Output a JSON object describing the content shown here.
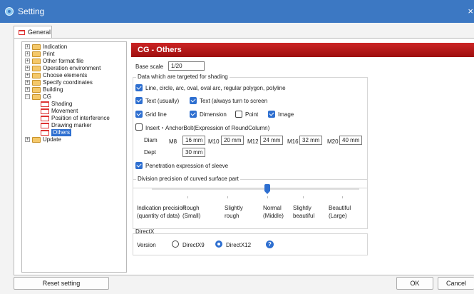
{
  "window": {
    "title": "Setting",
    "close_symbol": "×"
  },
  "tabs": [
    {
      "label": "General"
    }
  ],
  "tree": {
    "items": [
      {
        "label": "Indication",
        "expander": "+"
      },
      {
        "label": "Print",
        "expander": "+"
      },
      {
        "label": "Other format file",
        "expander": "+"
      },
      {
        "label": "Operation environment",
        "expander": "+"
      },
      {
        "label": "Choose elements",
        "expander": "+"
      },
      {
        "label": "Specify coordinates",
        "expander": "+"
      },
      {
        "label": "Building",
        "expander": "+"
      },
      {
        "label": "CG",
        "expander": "−"
      },
      {
        "label": "Shading"
      },
      {
        "label": "Movement"
      },
      {
        "label": "Position of interference"
      },
      {
        "label": "Drawing marker"
      },
      {
        "label": "Others",
        "selected": true
      },
      {
        "label": "Update",
        "expander": "+"
      }
    ]
  },
  "panel": {
    "header": "CG - Others",
    "base_scale": {
      "label": "Base scale",
      "value": "1/20"
    },
    "shading": {
      "title": "Data which are targeted for shading",
      "line_items": {
        "label": "Line, circle, arc, oval, oval arc, regular polygon, polyline",
        "checked": true
      },
      "text_usually": {
        "label": "Text (usually)",
        "checked": true
      },
      "text_screen": {
        "label": "Text (always turn to screen",
        "checked": true
      },
      "grid_line": {
        "label": "Grid line",
        "checked": true
      },
      "dimension": {
        "label": "Dimension",
        "checked": true
      },
      "point": {
        "label": "Point",
        "checked": false
      },
      "image": {
        "label": "Image",
        "checked": true
      },
      "insert_anchor": {
        "label": "Insert・AnchorBolt(Expression of RoundColumn)",
        "checked": false
      },
      "diam_label": "Diam",
      "dept_label": "Dept",
      "sizes": [
        {
          "label": "M8",
          "value": "16 mm"
        },
        {
          "label": "M10",
          "value": "20 mm"
        },
        {
          "label": "M12",
          "value": "24 mm"
        },
        {
          "label": "M16",
          "value": "32 mm"
        },
        {
          "label": "M20",
          "value": "40 mm"
        }
      ],
      "dept_value": "30 mm",
      "penetration": {
        "label": "Penetration expression of sleeve",
        "checked": true
      }
    },
    "division": {
      "title": "Division precision of curved surface part",
      "indication_label_1": "Indication precision",
      "indication_label_2": "(quantity of data)",
      "levels": [
        {
          "line1": "Rough",
          "line2": "(Small)"
        },
        {
          "line1": "Slightly",
          "line2": "rough"
        },
        {
          "line1": "Normal",
          "line2": "(Middle)"
        },
        {
          "line1": "Slightly",
          "line2": "beautiful"
        },
        {
          "line1": "Beautiful",
          "line2": "(Large)"
        }
      ],
      "selected_level": "Normal"
    },
    "directx": {
      "title": "DirectX",
      "version_label": "Version",
      "options": [
        {
          "label": "DirectX9",
          "checked": false
        },
        {
          "label": "DirectX12",
          "checked": true
        }
      ],
      "help_symbol": "?"
    }
  },
  "footer": {
    "reset_label": "Reset setting",
    "ok_label": "OK",
    "cancel_label": "Cancel"
  },
  "colors": {
    "titlebar": "#3c78c3",
    "header_red": "#b81818",
    "accent": "#2e6fd0"
  }
}
